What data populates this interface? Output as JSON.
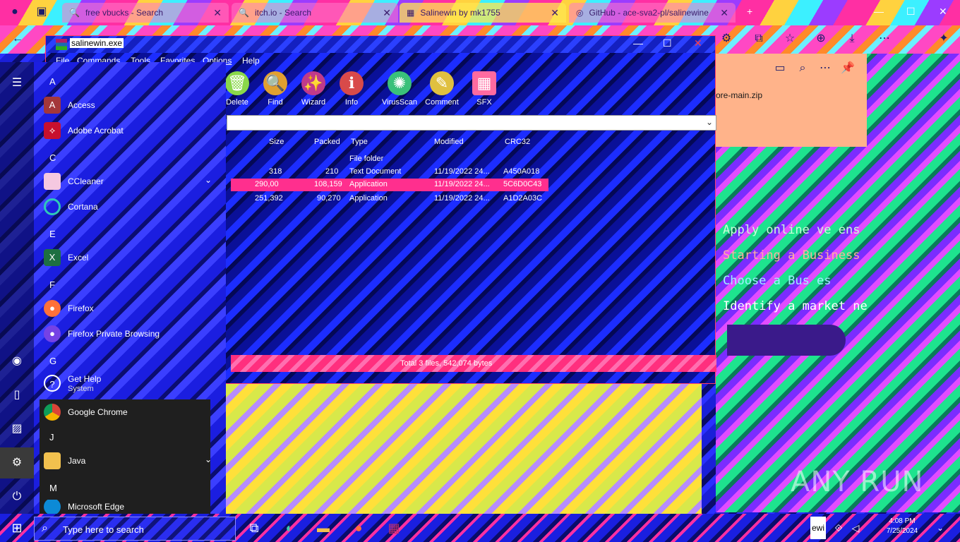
{
  "browser": {
    "tabs": [
      {
        "label": "free vbucks - Search"
      },
      {
        "label": "itch.io - Search"
      },
      {
        "label": "Salinewin by mk1755"
      },
      {
        "label": "GitHub - ace-sva2-pl/salinewine"
      }
    ],
    "controls": {
      "minimize": "—",
      "maximize": "☐",
      "close": "✕",
      "new_tab": "+"
    },
    "panel_filename": "ore-main.zip"
  },
  "winrar": {
    "title": "salinewin.exe",
    "menu": [
      "File",
      "Commands",
      "Tools",
      "Favorites",
      "Options",
      "Help"
    ],
    "toolbar": [
      {
        "label": "Delete",
        "icon": "trash-icon"
      },
      {
        "label": "Find",
        "icon": "magnifier-icon"
      },
      {
        "label": "Wizard",
        "icon": "wand-icon"
      },
      {
        "label": "Info",
        "icon": "info-icon"
      },
      {
        "label": "VirusScan",
        "icon": "virus-scan-icon"
      },
      {
        "label": "Comment",
        "icon": "comment-icon"
      },
      {
        "label": "SFX",
        "icon": "sfx-icon"
      }
    ],
    "columns": [
      "Size",
      "Packed",
      "Type",
      "Modified",
      "CRC32"
    ],
    "rows": [
      {
        "size": "",
        "packed": "",
        "type": "File folder",
        "modified": "",
        "crc": ""
      },
      {
        "size": "318",
        "packed": "210",
        "type": "Text Document",
        "modified": "11/19/2022 24...",
        "crc": "A450A018"
      },
      {
        "size": "290,00",
        "packed": "108,159",
        "type": "Application",
        "modified": "11/19/2022 24...",
        "crc": "5C6D0C43"
      },
      {
        "size": "251,392",
        "packed": "90,270",
        "type": "Application",
        "modified": "11/19/2022 24...",
        "crc": "A1D2A03C"
      }
    ],
    "status": "Total 3 files, 542,074 bytes"
  },
  "github_list": [
    "Apply online ve ens",
    "Starting a Business",
    "Choose a Bus  es",
    "Identify a market ne"
  ],
  "startmenu": {
    "letters": {
      "a": "A",
      "c": "C",
      "e": "E",
      "f": "F",
      "g": "G",
      "j": "J",
      "m": "M"
    },
    "apps": {
      "access": "Access",
      "acrobat": "Adobe Acrobat",
      "ccleaner": "CCleaner",
      "cortana": "Cortana",
      "excel": "Excel",
      "firefox": "Firefox",
      "firefox_private": "Firefox Private Browsing",
      "get_help": "Get Help",
      "get_help_sub": "System",
      "chrome": "Google Chrome",
      "java": "Java",
      "edge": "Microsoft Edge"
    }
  },
  "taskbar": {
    "search_placeholder": "Type here to search",
    "time": "4:08 PM",
    "date": "7/25/2024",
    "tray_label": "ewi"
  },
  "watermark": "ANY RUN"
}
